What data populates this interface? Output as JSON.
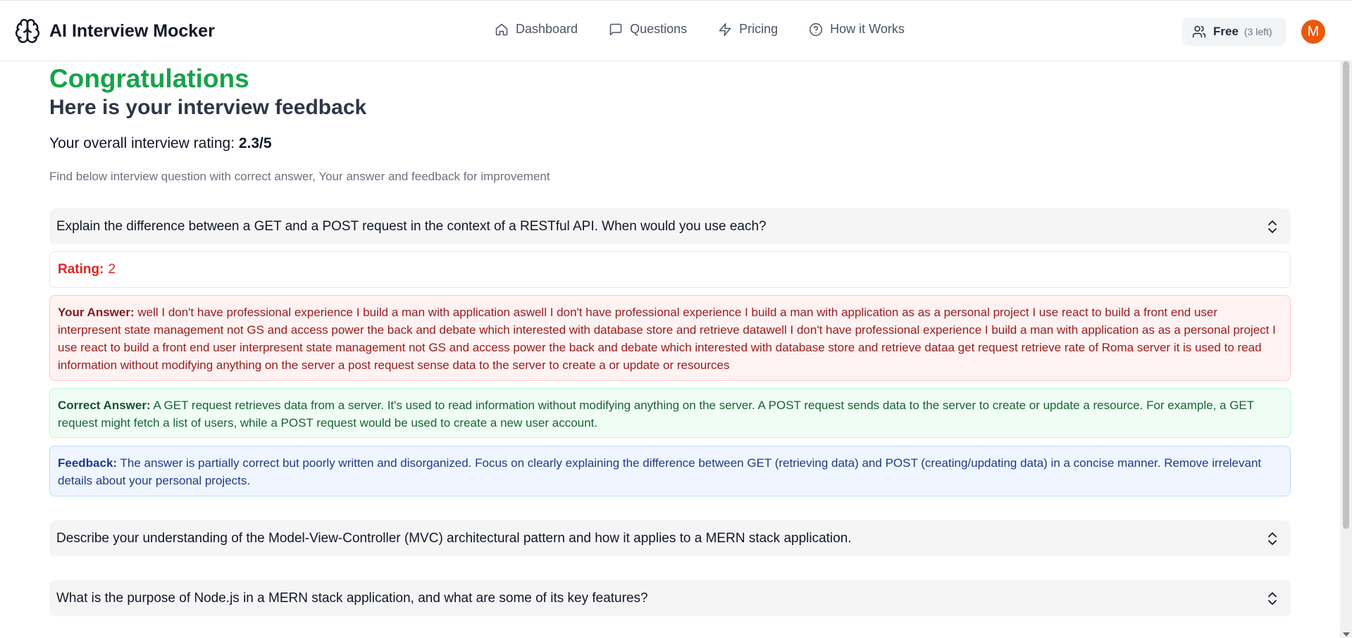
{
  "header": {
    "app_name": "AI Interview Mocker",
    "logo_icon": "brain-icon",
    "nav": [
      {
        "label": "Dashboard",
        "icon": "home-icon"
      },
      {
        "label": "Questions",
        "icon": "message-square-icon"
      },
      {
        "label": "Pricing",
        "icon": "zap-icon"
      },
      {
        "label": "How it Works",
        "icon": "help-circle-icon"
      }
    ],
    "plan": {
      "label": "Free",
      "remaining": "(3 left)",
      "icon": "users-icon"
    },
    "avatar_initial": "M",
    "avatar_color": "#ea580c"
  },
  "page": {
    "heading": "Congratulations",
    "subheading": "Here is your interview feedback",
    "overall_prefix": "Your overall interview rating: ",
    "overall_value": "2.3/5",
    "instruction": "Find below interview question with correct answer, Your answer and feedback for improvement"
  },
  "questions": [
    {
      "question": "Explain the difference between a GET and a POST request in the context of a RESTful API. When would you use each?",
      "expanded": true,
      "rating_label": "Rating:",
      "rating": "2",
      "your_answer_label": "Your Answer:",
      "your_answer": "well I don't have professional experience I build a man with application aswell I don't have professional experience I build a man with application as as a personal project I use react to build a front end user interpresent state management not GS and access power the back and debate which interested with database store and retrieve datawell I don't have professional experience I build a man with application as as a personal project I use react to build a front end user interpresent state management not GS and access power the back and debate which interested with database store and retrieve dataa get request retrieve rate of Roma server it is used to read information without modifying anything on the server a post request sense data to the server to create a or update or resources",
      "correct_answer_label": "Correct Answer:",
      "correct_answer": "A GET request retrieves data from a server. It's used to read information without modifying anything on the server. A POST request sends data to the server to create or update a resource. For example, a GET request might fetch a list of users, while a POST request would be used to create a new user account.",
      "feedback_label": "Feedback:",
      "feedback": "The answer is partially correct but poorly written and disorganized. Focus on clearly explaining the difference between GET (retrieving data) and POST (creating/updating data) in a concise manner. Remove irrelevant details about your personal projects."
    },
    {
      "question": "Describe your understanding of the Model-View-Controller (MVC) architectural pattern and how it applies to a MERN stack application.",
      "expanded": false
    },
    {
      "question": "What is the purpose of Node.js in a MERN stack application, and what are some of its key features?",
      "expanded": false
    }
  ],
  "colors": {
    "success_green": "#16a34a",
    "rating_red": "#dc2626",
    "answer_bg": "#fef2f2",
    "correct_bg": "#f0fdf4",
    "feedback_bg": "#eff6ff"
  }
}
